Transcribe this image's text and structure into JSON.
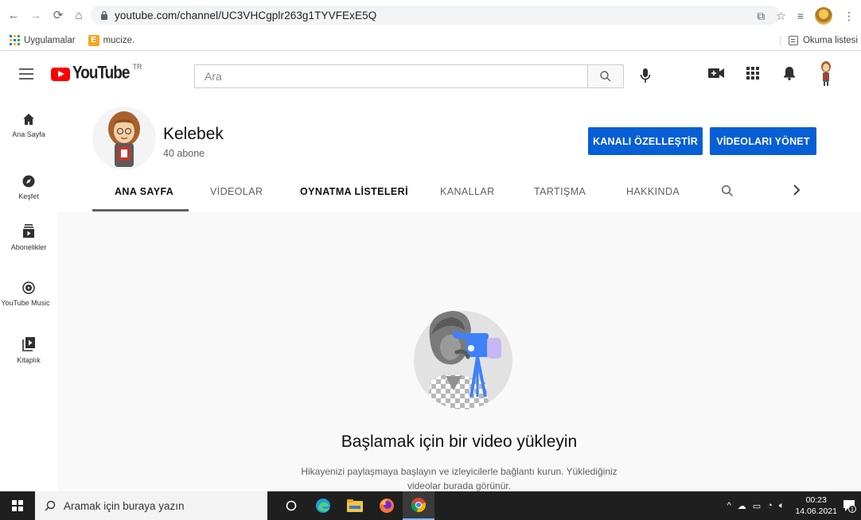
{
  "browser": {
    "url": "youtube.com/channel/UC3VHCgplr263g1TYVFExE5Q",
    "bookmarks": [
      {
        "label": "Uygulamalar"
      },
      {
        "label": "mucize."
      }
    ],
    "reading_list": "Okuma listesi"
  },
  "youtube": {
    "logo_word": "YouTube",
    "country_code": "TR",
    "search_placeholder": "Ara"
  },
  "guide": [
    {
      "label": "Ana Sayfa",
      "icon": "home-icon"
    },
    {
      "label": "Keşfet",
      "icon": "compass-icon"
    },
    {
      "label": "Abonelikler",
      "icon": "subscriptions-icon"
    },
    {
      "label": "YouTube Music",
      "icon": "music-icon"
    },
    {
      "label": "Kitaplık",
      "icon": "library-icon"
    }
  ],
  "channel": {
    "name": "Kelebek",
    "subscribers": "40 abone",
    "customize_button": "KANALI ÖZELLEŞTİR",
    "manage_button": "VİDEOLARI YÖNET",
    "tabs": [
      "ANA SAYFA",
      "VİDEOLAR",
      "OYNATMA LİSTELERİ",
      "KANALLAR",
      "TARTIŞMA",
      "HAKKINDA"
    ],
    "active_tab": "ANA SAYFA"
  },
  "empty_state": {
    "title": "Başlamak için bir video yükleyin",
    "description": "Hikayenizi paylaşmaya başlayın ve izleyicilerle bağlantı kurun. Yüklediğiniz videolar burada görünür."
  },
  "taskbar": {
    "search_placeholder": "Aramak için buraya yazın",
    "time": "00:23",
    "date": "14.06.2021",
    "notification_count": "1"
  },
  "colors": {
    "brand_red": "#ff0000",
    "button_blue": "#065fd4",
    "content_bg": "#f9f9f9"
  }
}
